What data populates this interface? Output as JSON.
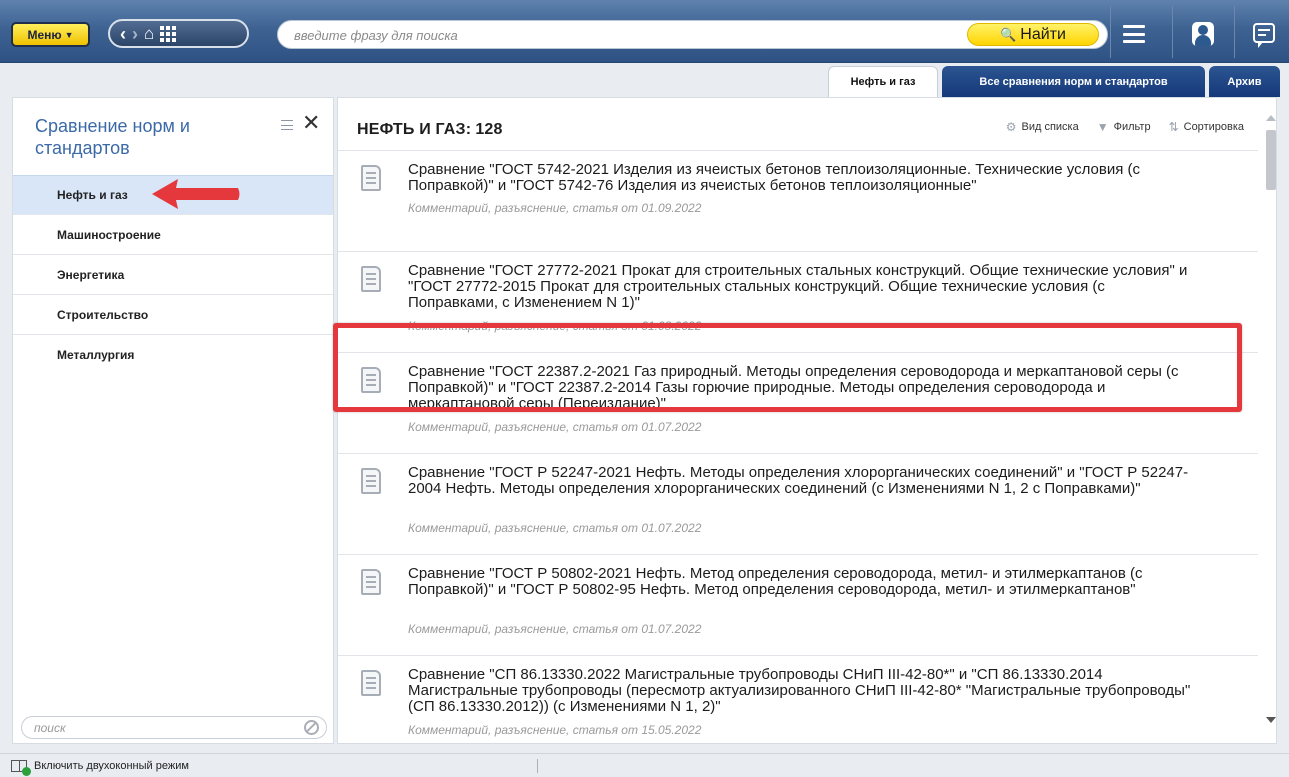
{
  "topbar": {
    "menu_label": "Меню",
    "search_placeholder": "введите фразу для поиска",
    "find_label": "Найти"
  },
  "tabs": [
    {
      "label": "Нефть и газ",
      "active": true
    },
    {
      "label": "Все сравнения норм и стандартов",
      "active": false
    },
    {
      "label": "Архив",
      "active": false
    }
  ],
  "sidebar": {
    "title": "Сравнение норм и стандартов",
    "items": [
      {
        "label": "Нефть и газ",
        "active": true
      },
      {
        "label": "Машиностроение",
        "active": false
      },
      {
        "label": "Энергетика",
        "active": false
      },
      {
        "label": "Строительство",
        "active": false
      },
      {
        "label": "Металлургия",
        "active": false
      }
    ],
    "search_placeholder": "поиск"
  },
  "main": {
    "title": "НЕФТЬ И ГАЗ:",
    "count": "128",
    "tools": {
      "view": "Вид списка",
      "filter": "Фильтр",
      "sort": "Сортировка"
    },
    "documents": [
      {
        "title": "Сравнение \"ГОСТ 5742-2021 Изделия из ячеистых бетонов теплоизоляционные. Технические условия (с Поправкой)\" и \"ГОСТ 5742-76 Изделия из ячеистых бетонов теплоизоляционные\"",
        "meta": "Комментарий, разъяснение, статья от 01.09.2022"
      },
      {
        "title": "Сравнение \"ГОСТ 27772-2021 Прокат для строительных стальных конструкций. Общие технические условия\" и \"ГОСТ 27772-2015 Прокат для строительных стальных конструкций. Общие технические условия (с Поправками, с Изменением N 1)\"",
        "meta": "Комментарий, разъяснение, статья от 01.08.2022"
      },
      {
        "title": "Сравнение \"ГОСТ 22387.2-2021 Газ природный. Методы определения сероводорода и меркаптановой серы (с Поправкой)\" и \"ГОСТ 22387.2-2014 Газы горючие природные. Методы определения сероводорода и меркаптановой серы (Переиздание)\"",
        "meta": "Комментарий, разъяснение, статья от 01.07.2022"
      },
      {
        "title": "Сравнение \"ГОСТ Р 52247-2021 Нефть. Методы определения хлорорганических соединений\" и \"ГОСТ Р 52247-2004 Нефть. Методы определения хлорорганических соединений (с Изменениями N 1, 2 с Поправками)\"",
        "meta": "Комментарий, разъяснение, статья от 01.07.2022"
      },
      {
        "title": "Сравнение \"ГОСТ Р 50802-2021 Нефть. Метод определения сероводорода, метил- и этилмеркаптанов (с Поправкой)\" и \"ГОСТ Р 50802-95 Нефть. Метод определения сероводорода, метил- и этилмеркаптанов\"",
        "meta": "Комментарий, разъяснение, статья от 01.07.2022"
      },
      {
        "title": "Сравнение \"СП 86.13330.2022 Магистральные трубопроводы СНиП III-42-80*\" и \"СП 86.13330.2014 Магистральные трубопроводы (пересмотр актуализированного СНиП III-42-80* \"Магистральные трубопроводы\" (СП 86.13330.2012)) (с Изменениями N 1, 2)\"",
        "meta": "Комментарий, разъяснение, статья от 15.05.2022"
      }
    ]
  },
  "statusbar": {
    "two_window_label": "Включить двухоконный режим"
  },
  "colors": {
    "accent": "#3b6aa6",
    "highlight": "#e4383d",
    "find_button": "#ffd400"
  }
}
